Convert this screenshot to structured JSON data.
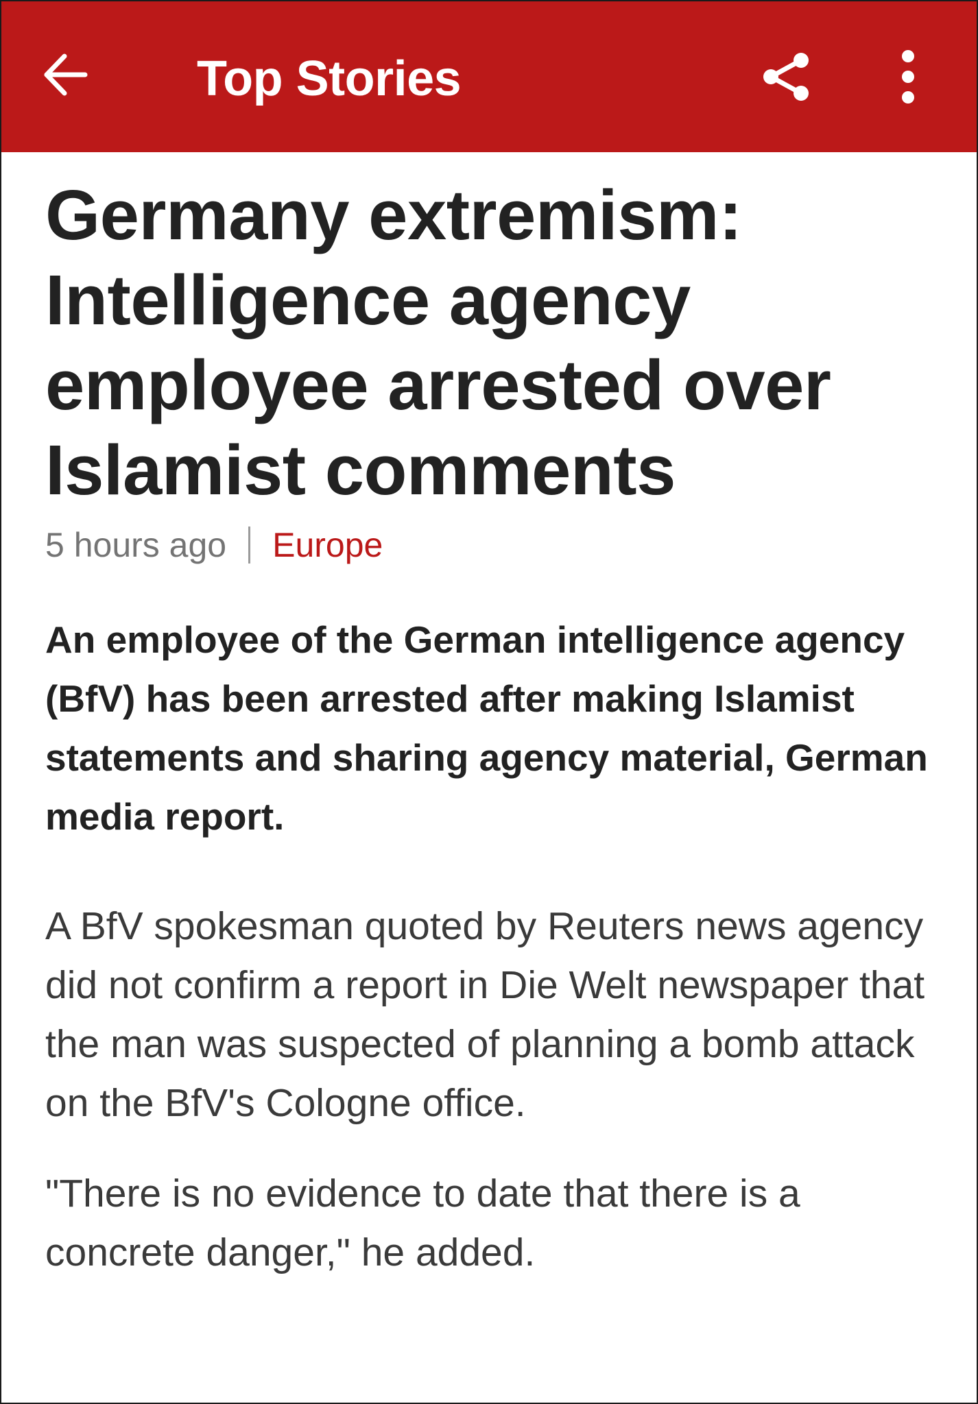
{
  "app_bar": {
    "title": "Top Stories",
    "background_color": "#bb1919",
    "icons": {
      "back": "arrow-left-icon",
      "share": "share-icon",
      "more": "more-vertical-icon"
    }
  },
  "article": {
    "headline": "Germany extremism: Intelligence agency employee arrested over Islamist comments",
    "timestamp": "5 hours ago",
    "separator": "|",
    "section": "Europe",
    "section_color": "#bb1919",
    "summary": "An employee of the German intelligence agency (BfV) has been arrested after making Islamist statements and sharing agency material, German media report.",
    "paragraphs": [
      "A BfV spokesman quoted by Reuters news agency did not confirm a report in Die Welt newspaper that the man was suspected of planning a bomb attack on the BfV's Cologne office.",
      "\"There is no evidence to date that there is a concrete danger,\" he added."
    ]
  }
}
